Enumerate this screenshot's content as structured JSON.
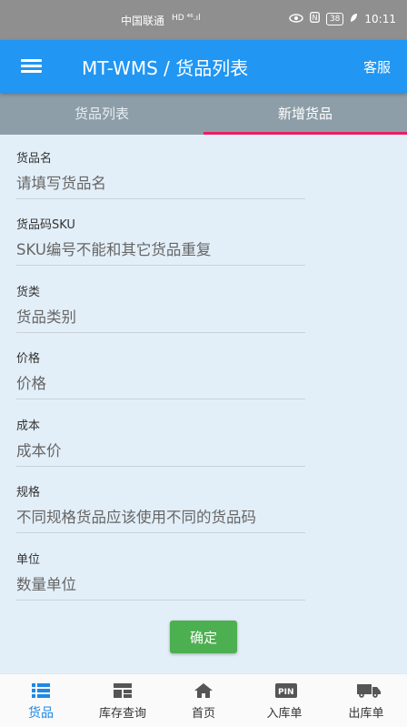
{
  "status_bar": {
    "carrier": "中国联通",
    "network": "HD ⁴⁶.ıl",
    "battery": "38",
    "time": "10:11"
  },
  "app_bar": {
    "title": "MT-WMS / 货品列表",
    "service_label": "客服"
  },
  "tabs": [
    {
      "label": "货品列表",
      "active": false
    },
    {
      "label": "新增货品",
      "active": true
    }
  ],
  "form": {
    "fields": [
      {
        "label": "货品名",
        "placeholder": "请填写货品名",
        "value": ""
      },
      {
        "label": "货品码SKU",
        "placeholder": "SKU编号不能和其它货品重复",
        "value": ""
      },
      {
        "label": "货类",
        "placeholder": "货品类别",
        "value": ""
      },
      {
        "label": "价格",
        "placeholder": "价格",
        "value": ""
      },
      {
        "label": "成本",
        "placeholder": "成本价",
        "value": ""
      },
      {
        "label": "规格",
        "placeholder": "不同规格货品应该使用不同的货品码",
        "value": ""
      },
      {
        "label": "单位",
        "placeholder": "数量单位",
        "value": ""
      }
    ],
    "confirm_label": "确定"
  },
  "bottom_nav": [
    {
      "label": "货品",
      "icon": "list-icon",
      "active": true
    },
    {
      "label": "库存查询",
      "icon": "grid-icon",
      "active": false
    },
    {
      "label": "首页",
      "icon": "home-icon",
      "active": false
    },
    {
      "label": "入库单",
      "icon": "pin-icon",
      "active": false
    },
    {
      "label": "出库单",
      "icon": "truck-icon",
      "active": false
    }
  ],
  "colors": {
    "app_bar": "#2196f3",
    "tab_bar": "#8e9ea8",
    "tab_indicator": "#e91e63",
    "confirm": "#4caf50",
    "nav_active": "#1e88e5",
    "background": "#e3eff8"
  }
}
